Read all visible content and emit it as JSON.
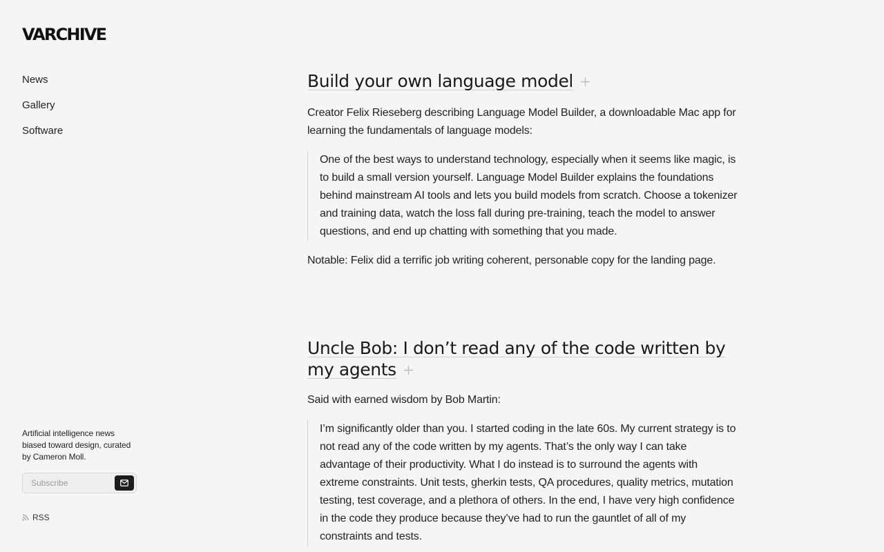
{
  "brand": {
    "logo": "VARCHIVE"
  },
  "nav": {
    "items": [
      "News",
      "Gallery",
      "Software"
    ]
  },
  "sidebar": {
    "tagline": "Artificial intelligence news biased toward design, curated by Cameron Moll.",
    "subscribe_placeholder": "Subscribe",
    "subscribe_icon": "mail-icon",
    "rss_label": "RSS"
  },
  "posts": [
    {
      "title": "Build your own language model",
      "intro": "Creator Felix Rieseberg describing Language Model Builder, a downloadable Mac app for learning the fundamentals of language models:",
      "quote": "One of the best ways to understand technology, especially when it seems like magic, is to build a small version yourself. Language Model Builder explains the foundations behind mainstream AI tools and lets you build models from scratch. Choose a tokenizer and training data, watch the loss fall during pre-training, teach the model to answer questions, and end up chatting with something that you made.",
      "note": "Notable: Felix did a terrific job writing coherent, personable copy for the landing page."
    },
    {
      "title": "Uncle Bob: I don’t read any of the code written by my agents",
      "intro": "Said with earned wisdom by Bob Martin:",
      "quote": "I’m significantly older than you. I started coding in the late 60s. My current strategy is to not read any of the code written by my agents. That’s the only way I can take advantage of their productivity. What I do instead is to surround the agents with extreme constraints. Unit tests, gherkin tests, QA procedures, quality metrics, mutation testing, test coverage, and a plethora of others. In the end, I have very high confidence in the code they produce because they’ve had to run the gauntlet of all of my constraints and tests."
    }
  ]
}
